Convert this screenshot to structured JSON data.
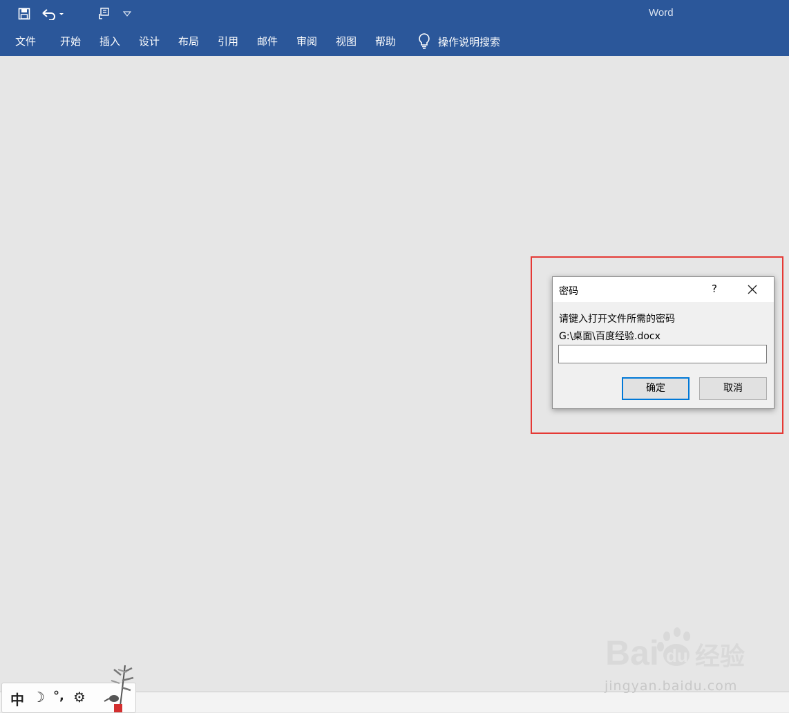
{
  "app": {
    "title": "Word"
  },
  "ribbon": {
    "tabs": [
      "文件",
      "开始",
      "插入",
      "设计",
      "布局",
      "引用",
      "邮件",
      "审阅",
      "视图",
      "帮助"
    ],
    "tell_me": "操作说明搜索"
  },
  "dialog": {
    "title": "密码",
    "help": "?",
    "prompt": "请键入打开文件所需的密码",
    "file_path": "G:\\桌面\\百度经验.docx",
    "password_value": "",
    "ok_label": "确定",
    "cancel_label": "取消"
  },
  "ime": {
    "mode": "中",
    "moon": "☽",
    "punct": "°,",
    "settings": "⚙"
  },
  "watermark": {
    "brand": "Bai du 经验",
    "url": "jingyan.baidu.com"
  },
  "colors": {
    "ribbon": "#2b579a",
    "highlight": "#e53935",
    "accent": "#0078d7"
  }
}
